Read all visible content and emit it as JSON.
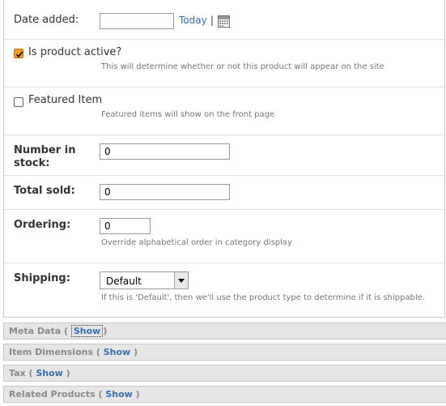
{
  "date_added": {
    "label": "Date added:",
    "value": "",
    "today_link": "Today",
    "separator": "|",
    "calendar_icon": "calendar-icon"
  },
  "is_active": {
    "label": "Is product active?",
    "checked": true,
    "help": "This will determine whether or not this product will appear on the site"
  },
  "featured": {
    "label": "Featured Item",
    "checked": false,
    "help": "Featured items will show on the front page"
  },
  "number_in_stock": {
    "label_line1": "Number in",
    "label_line2": "stock:",
    "value": "0"
  },
  "total_sold": {
    "label": "Total sold:",
    "value": "0"
  },
  "ordering": {
    "label": "Ordering:",
    "value": "0",
    "help": "Override alphabetical order in category display"
  },
  "shipping": {
    "label": "Shipping:",
    "selected": "Default",
    "help": "If this is 'Default', then we'll use the product type to determine if it is shippable."
  },
  "collapsed_sections": [
    {
      "title": "Meta Data",
      "open": "(",
      "toggle": "Show",
      "close": ")"
    },
    {
      "title": "Item Dimensions",
      "open": "(",
      "toggle": "Show",
      "close": ")"
    },
    {
      "title": "Tax",
      "open": "(",
      "toggle": "Show",
      "close": ")"
    },
    {
      "title": "Related Products",
      "open": "(",
      "toggle": "Show",
      "close": ")"
    }
  ],
  "colors": {
    "link": "#3a6eae",
    "checkbox_checked": "#f39d22",
    "section_bg": "#e6e6e6"
  }
}
